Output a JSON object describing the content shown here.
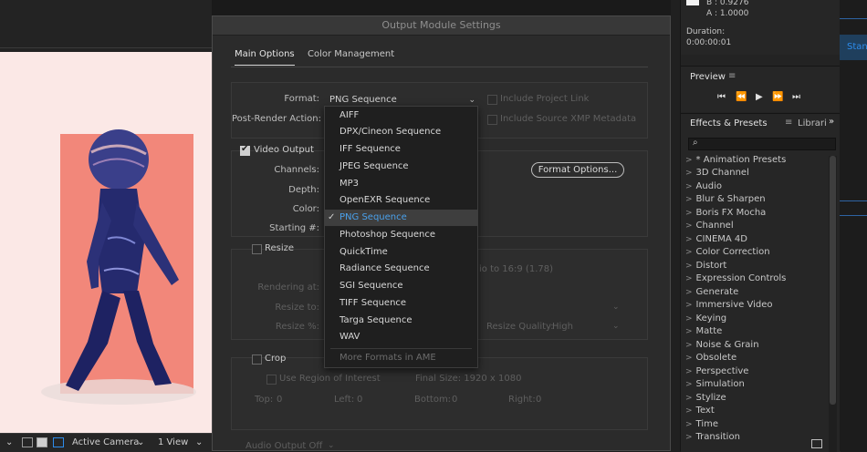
{
  "dialog": {
    "title": "Output Module Settings",
    "tabs": [
      "Main Options",
      "Color Management"
    ],
    "format_label": "Format:",
    "format_value": "PNG Sequence",
    "post_render_label": "Post-Render Action:",
    "include_project_link": "Include Project Link",
    "include_xmp": "Include Source XMP Metadata",
    "video_output": "Video Output",
    "channels_label": "Channels:",
    "depth_label": "Depth:",
    "color_label": "Color:",
    "starting_label": "Starting #:",
    "format_options_button": "Format Options...",
    "resize_label": "Resize",
    "rendering_at_label": "Rendering at:",
    "resize_to_label": "Resize to:",
    "resize_pct_label": "Resize %:",
    "ratio_text": "io to 16:9 (1.78)",
    "resize_quality_label": "Resize Quality:",
    "resize_quality_value": "High",
    "crop_label": "Crop",
    "use_roi": "Use Region of Interest",
    "final_size": "Final Size: 1920 x 1080",
    "crop_top": "Top:",
    "crop_top_val": "0",
    "crop_left": "Left:",
    "crop_left_val": "0",
    "crop_bottom": "Bottom:",
    "crop_bottom_val": "0",
    "crop_right": "Right:",
    "crop_right_val": "0",
    "audio_output": "Audio Output Off"
  },
  "dropdown": {
    "items": [
      "AIFF",
      "DPX/Cineon Sequence",
      "IFF Sequence",
      "JPEG Sequence",
      "MP3",
      "OpenEXR Sequence",
      "PNG Sequence",
      "Photoshop Sequence",
      "QuickTime",
      "Radiance Sequence",
      "SGI Sequence",
      "TIFF Sequence",
      "Targa Sequence",
      "WAV"
    ],
    "selected_index": 6,
    "more": "More Formats in AME"
  },
  "info": {
    "b": "B :  0.9276",
    "a": "A :  1.0000",
    "duration_label": "Duration:",
    "duration_value": "0:00:00:01"
  },
  "preview": {
    "title": "Preview"
  },
  "effects": {
    "title": "Effects & Presets",
    "tab2": "Librari",
    "items": [
      "* Animation Presets",
      "3D Channel",
      "Audio",
      "Blur & Sharpen",
      "Boris FX Mocha",
      "Channel",
      "CINEMA 4D",
      "Color Correction",
      "Distort",
      "Expression Controls",
      "Generate",
      "Immersive Video",
      "Keying",
      "Matte",
      "Noise & Grain",
      "Obsolete",
      "Perspective",
      "Simulation",
      "Stylize",
      "Text",
      "Time",
      "Transition"
    ]
  },
  "viewer": {
    "camera": "Active Camera",
    "views": "1 View"
  },
  "far_right": {
    "label": "Stan"
  },
  "colors": {
    "accent": "#4aa0ea",
    "canvas_bg": "#fbe8e6",
    "figure_bg": "#f2877a"
  }
}
